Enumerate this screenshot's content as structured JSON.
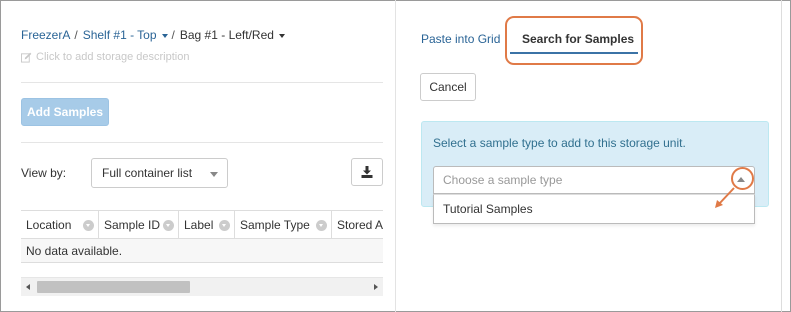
{
  "breadcrumb": {
    "items": [
      {
        "label": "FreezerA"
      },
      {
        "label": "Shelf #1 - Top"
      },
      {
        "label": "Bag #1 - Left/Red"
      }
    ],
    "separator": "/"
  },
  "storage_description_placeholder": "Click to add storage description",
  "add_samples_label": "Add Samples",
  "view_by": {
    "label": "View by:",
    "selected": "Full container list"
  },
  "grid": {
    "columns": [
      {
        "label": "Location"
      },
      {
        "label": "Sample ID"
      },
      {
        "label": "Label"
      },
      {
        "label": "Sample Type"
      },
      {
        "label": "Stored Ar"
      }
    ],
    "empty_text": "No data available."
  },
  "tabs": [
    {
      "label": "Paste into Grid",
      "active": false
    },
    {
      "label": "Search for Samples",
      "active": true
    }
  ],
  "cancel_label": "Cancel",
  "info_text": "Select a sample type to add to this storage unit.",
  "sample_type_select": {
    "placeholder": "Choose a sample type",
    "options": [
      "Tutorial Samples"
    ]
  },
  "colors": {
    "link": "#2a6496",
    "highlight": "#e07a47",
    "info_bg": "#d9edf7",
    "info_text": "#31708f",
    "add_button_disabled": "#a7cbe8"
  }
}
